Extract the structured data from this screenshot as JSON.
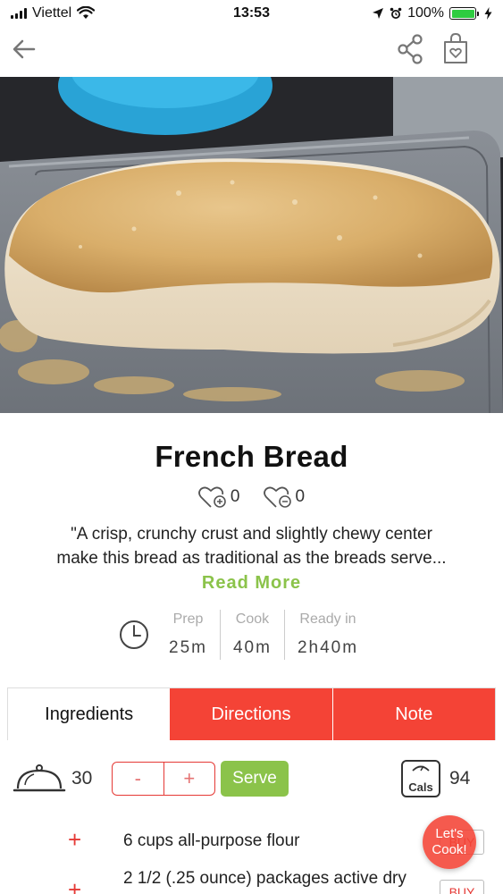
{
  "status_bar": {
    "carrier": "Viettel",
    "time": "13:53",
    "battery": "100%"
  },
  "nav": {
    "icons": [
      "back-arrow-icon",
      "share-icon",
      "shopping-bag-icon"
    ]
  },
  "recipe": {
    "title": "French Bread",
    "likes": "0",
    "dislikes": "0",
    "description_line1": "\"A crisp, crunchy crust and slightly chewy center",
    "description_line2": "make this bread as traditional as the breads serve...",
    "read_more": "Read More",
    "times": [
      {
        "label": "Prep",
        "value": "25m"
      },
      {
        "label": "Cook",
        "value": "40m"
      },
      {
        "label": "Ready in",
        "value": "2h40m"
      }
    ]
  },
  "tabs": [
    {
      "label": "Ingredients",
      "active": true
    },
    {
      "label": "Directions",
      "active": false
    },
    {
      "label": "Note",
      "active": false
    }
  ],
  "serving": {
    "servings": "30",
    "minus": "-",
    "plus": "+",
    "serve_label": "Serve",
    "cals_icon_label": "Cals",
    "calories": "94"
  },
  "ingredients": [
    {
      "text": "6 cups all-purpose flour",
      "buy": "BUY"
    },
    {
      "text": "2 1/2 (.25 ounce) packages active dry",
      "buy": "BUY"
    }
  ],
  "fab": {
    "line1": "Let's",
    "line2": "Cook!"
  },
  "colors": {
    "accent_red": "#f44336",
    "accent_green": "#8bc34a"
  }
}
